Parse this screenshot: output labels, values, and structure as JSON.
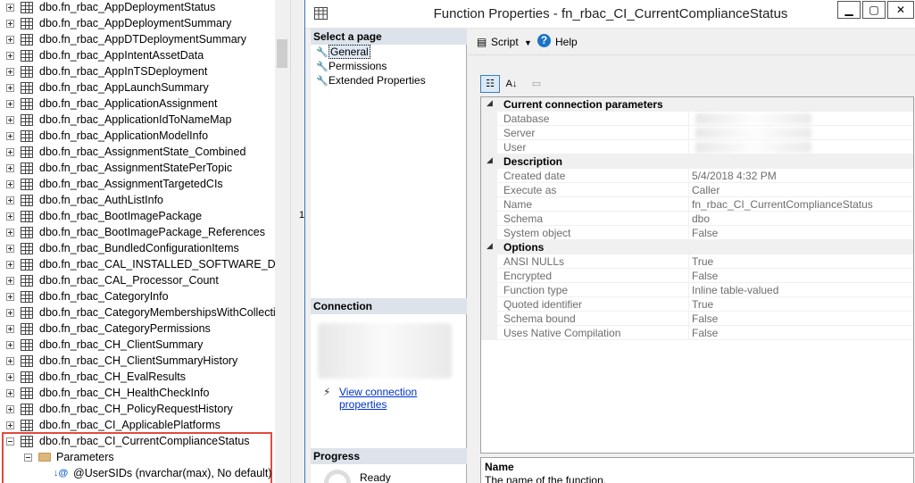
{
  "tree": {
    "items": [
      "dbo.fn_rbac_AppDeploymentStatus",
      "dbo.fn_rbac_AppDeploymentSummary",
      "dbo.fn_rbac_AppDTDeploymentSummary",
      "dbo.fn_rbac_AppIntentAssetData",
      "dbo.fn_rbac_AppInTSDeployment",
      "dbo.fn_rbac_AppLaunchSummary",
      "dbo.fn_rbac_ApplicationAssignment",
      "dbo.fn_rbac_ApplicationIdToNameMap",
      "dbo.fn_rbac_ApplicationModelInfo",
      "dbo.fn_rbac_AssignmentState_Combined",
      "dbo.fn_rbac_AssignmentStatePerTopic",
      "dbo.fn_rbac_AssignmentTargetedCIs",
      "dbo.fn_rbac_AuthListInfo",
      "dbo.fn_rbac_BootImagePackage",
      "dbo.fn_rbac_BootImagePackage_References",
      "dbo.fn_rbac_BundledConfigurationItems",
      "dbo.fn_rbac_CAL_INSTALLED_SOFTWARE_DATA",
      "dbo.fn_rbac_CAL_Processor_Count",
      "dbo.fn_rbac_CategoryInfo",
      "dbo.fn_rbac_CategoryMembershipsWithCollection",
      "dbo.fn_rbac_CategoryPermissions",
      "dbo.fn_rbac_CH_ClientSummary",
      "dbo.fn_rbac_CH_ClientSummaryHistory",
      "dbo.fn_rbac_CH_EvalResults",
      "dbo.fn_rbac_CH_HealthCheckInfo",
      "dbo.fn_rbac_CH_PolicyRequestHistory",
      "dbo.fn_rbac_CI_ApplicablePlatforms"
    ],
    "selected_item": "dbo.fn_rbac_CI_CurrentComplianceStatus",
    "parameters_folder": "Parameters",
    "parameter_item": "@UserSIDs (nvarchar(max), No default)",
    "splitter_digit": "1"
  },
  "dialog": {
    "title": "Function Properties - fn_rbac_CI_CurrentComplianceStatus",
    "select_page_header": "Select a page",
    "pages": [
      "General",
      "Permissions",
      "Extended Properties"
    ],
    "selected_page": "General",
    "connection_header": "Connection",
    "connection_link": "View connection properties",
    "progress_header": "Progress",
    "progress_status": "Ready",
    "toolbar": {
      "script": "Script",
      "help": "Help"
    },
    "categories": [
      {
        "name": "Current connection parameters",
        "props": [
          {
            "name": "Database",
            "value": ""
          },
          {
            "name": "Server",
            "value": ""
          },
          {
            "name": "User",
            "value": ""
          }
        ]
      },
      {
        "name": "Description",
        "props": [
          {
            "name": "Created date",
            "value": "5/4/2018 4:32 PM"
          },
          {
            "name": "Execute as",
            "value": "Caller"
          },
          {
            "name": "Name",
            "value": "fn_rbac_CI_CurrentComplianceStatus"
          },
          {
            "name": "Schema",
            "value": "dbo"
          },
          {
            "name": "System object",
            "value": "False"
          }
        ]
      },
      {
        "name": "Options",
        "props": [
          {
            "name": "ANSI NULLs",
            "value": "True"
          },
          {
            "name": "Encrypted",
            "value": "False"
          },
          {
            "name": "Function type",
            "value": "Inline table-valued"
          },
          {
            "name": "Quoted identifier",
            "value": "True"
          },
          {
            "name": "Schema bound",
            "value": "False"
          },
          {
            "name": "Uses Native Compilation",
            "value": "False"
          }
        ]
      }
    ],
    "desc_title": "Name",
    "desc_text": "The name of the function."
  }
}
